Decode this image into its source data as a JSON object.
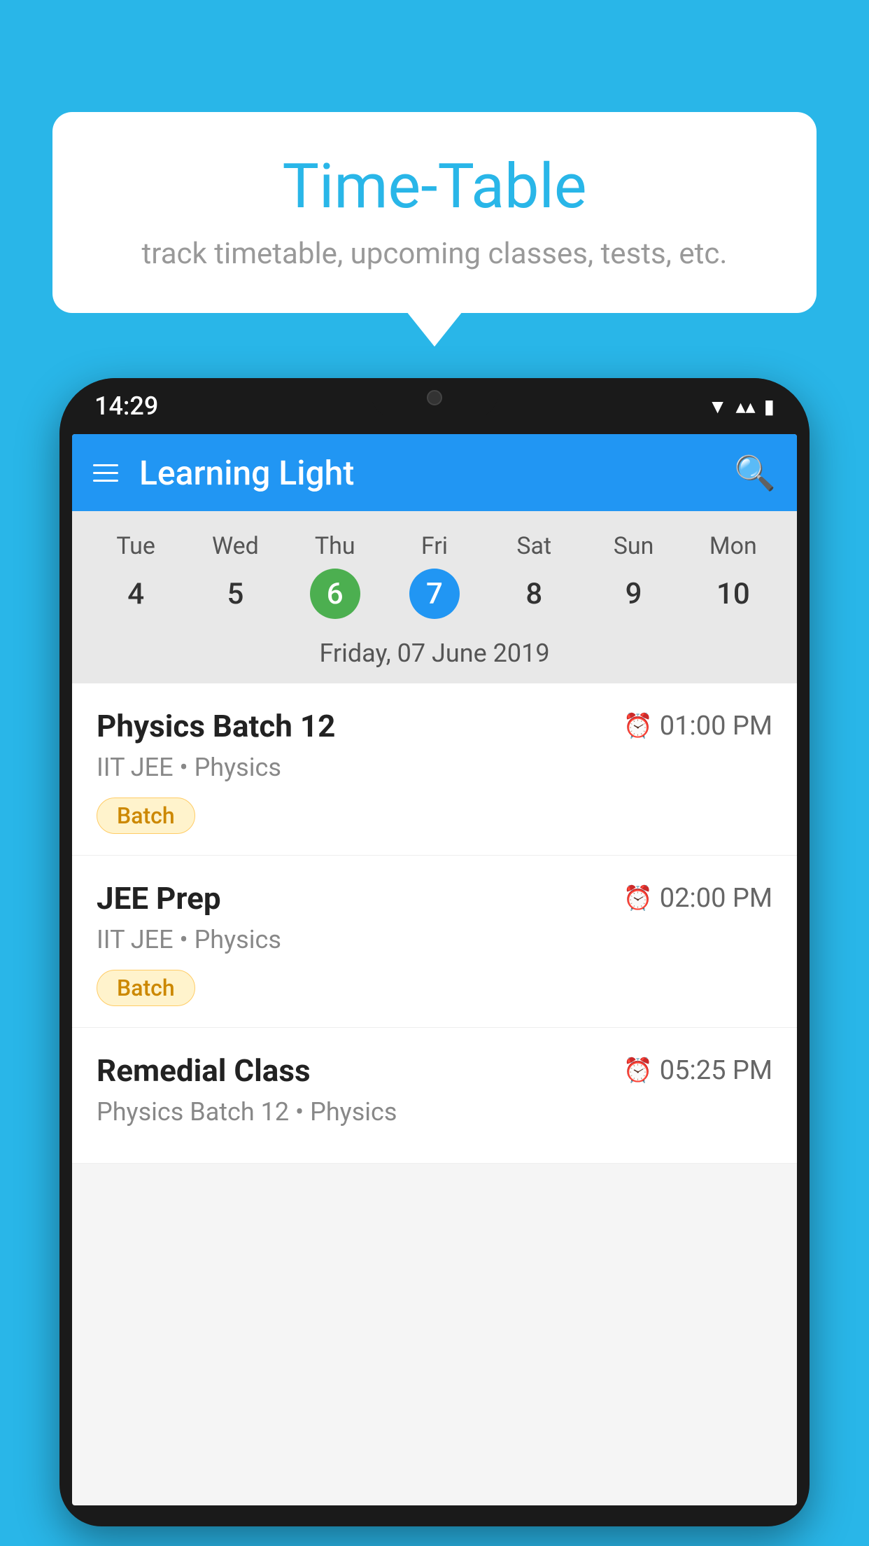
{
  "background_color": "#29B6E8",
  "bubble": {
    "title": "Time-Table",
    "subtitle": "track timetable, upcoming classes, tests, etc."
  },
  "phone": {
    "status_bar": {
      "time": "14:29"
    },
    "app_header": {
      "title": "Learning Light"
    },
    "calendar": {
      "days": [
        {
          "name": "Tue",
          "num": "4",
          "state": "normal"
        },
        {
          "name": "Wed",
          "num": "5",
          "state": "normal"
        },
        {
          "name": "Thu",
          "num": "6",
          "state": "today"
        },
        {
          "name": "Fri",
          "num": "7",
          "state": "selected"
        },
        {
          "name": "Sat",
          "num": "8",
          "state": "normal"
        },
        {
          "name": "Sun",
          "num": "9",
          "state": "normal"
        },
        {
          "name": "Mon",
          "num": "10",
          "state": "normal"
        }
      ],
      "selected_date_label": "Friday, 07 June 2019"
    },
    "classes": [
      {
        "name": "Physics Batch 12",
        "time": "01:00 PM",
        "subject": "IIT JEE • Physics",
        "tag": "Batch"
      },
      {
        "name": "JEE Prep",
        "time": "02:00 PM",
        "subject": "IIT JEE • Physics",
        "tag": "Batch"
      },
      {
        "name": "Remedial Class",
        "time": "05:25 PM",
        "subject": "Physics Batch 12 • Physics",
        "tag": null
      }
    ]
  }
}
